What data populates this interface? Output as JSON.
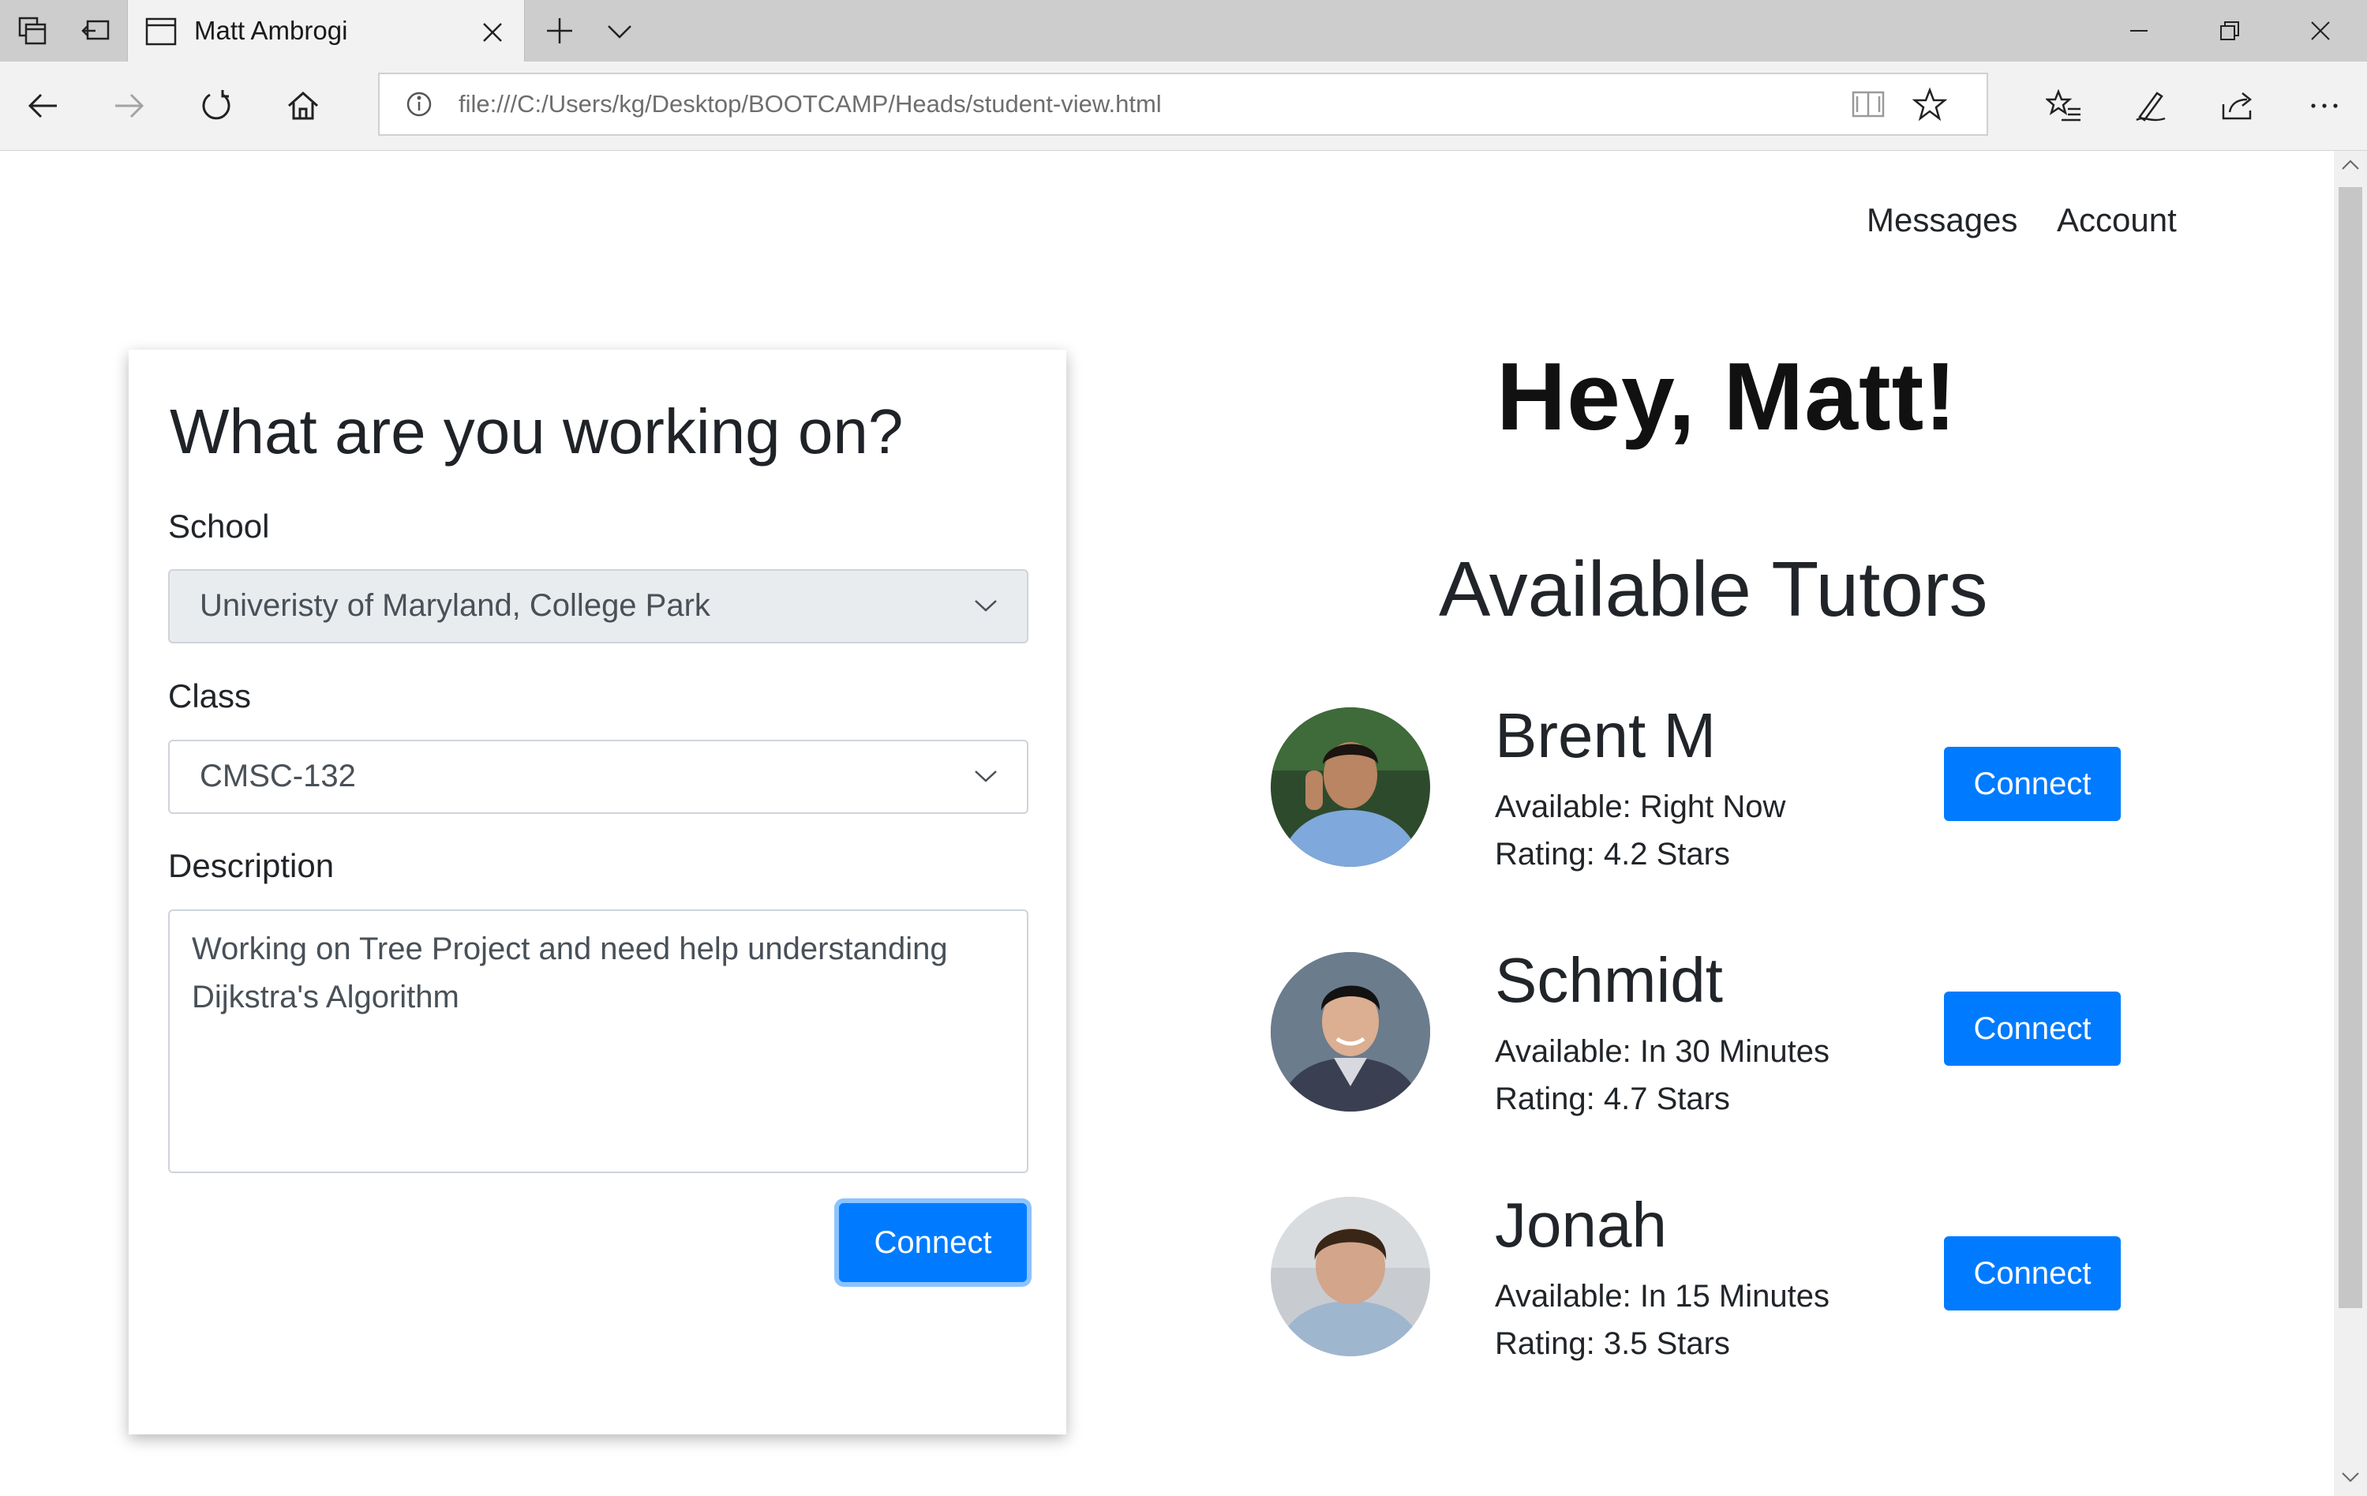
{
  "browser": {
    "tab_title": "Matt Ambrogi",
    "url": "file:///C:/Users/kg/Desktop/BOOTCAMP/Heads/student-view.html"
  },
  "nav": {
    "messages": "Messages",
    "account": "Account"
  },
  "form": {
    "title": "What are you working on?",
    "school_label": "School",
    "school_value": "Univeristy of Maryland, College Park",
    "class_label": "Class",
    "class_value": "CMSC-132",
    "description_label": "Description",
    "description_value": "Working on Tree Project and need help understanding Dijkstra's Algorithm",
    "connect_label": "Connect"
  },
  "greeting": "Hey, Matt!",
  "tutors_heading": "Available Tutors",
  "tutors": [
    {
      "name": "Brent M",
      "availability": "Available: Right Now",
      "rating": "Rating: 4.2 Stars",
      "connect_label": "Connect"
    },
    {
      "name": "Schmidt",
      "availability": "Available: In 30 Minutes",
      "rating": "Rating: 4.7 Stars",
      "connect_label": "Connect"
    },
    {
      "name": "Jonah",
      "availability": "Available: In 15 Minutes",
      "rating": "Rating: 3.5 Stars",
      "connect_label": "Connect"
    }
  ],
  "colors": {
    "primary": "#007bff",
    "select_disabled_bg": "#e9ecef",
    "border": "#ced4da"
  }
}
